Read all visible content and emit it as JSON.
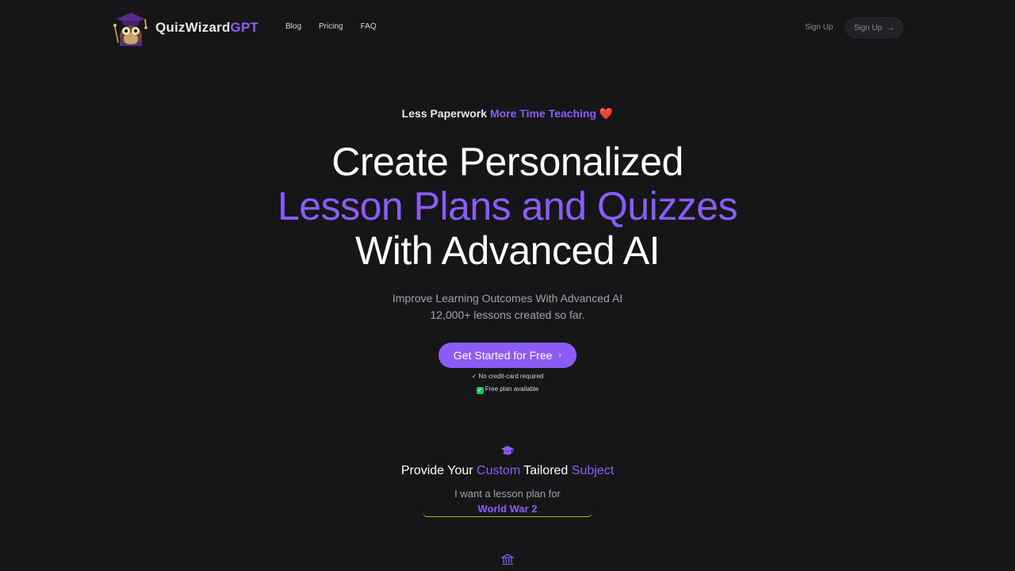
{
  "header": {
    "brand_main": "QuizWizard",
    "brand_accent": "GPT",
    "nav": [
      "Blog",
      "Pricing",
      "FAQ"
    ],
    "signup_link": "Sign Up",
    "signup_button": "Sign Up",
    "signup_button_icon": "arrow-right-icon"
  },
  "hero": {
    "kicker_plain": "Less Paperwork",
    "kicker_accent": "More Time Teaching",
    "kicker_emoji": "❤️",
    "headline_1": "Create Personalized",
    "headline_2": "Lesson Plans and Quizzes",
    "headline_3": "With Advanced AI",
    "sub_1": "Improve Learning Outcomes With Advanced AI",
    "sub_2": "12,000+ lessons created so far.",
    "cta_label": "Get Started for Free",
    "note_1": "✓ No credit-card required",
    "note_2": "Free plan available"
  },
  "subject": {
    "title_1": "Provide Your",
    "title_accent_1": "Custom",
    "title_2": "Tailored",
    "title_accent_2": "Subject",
    "prompt": "I want a lesson plan for",
    "value": "World War 2"
  },
  "colors": {
    "background": "#161618",
    "accent": "#8b5cf6",
    "input_underline": "#84cc16",
    "check_green": "#22c55e"
  }
}
